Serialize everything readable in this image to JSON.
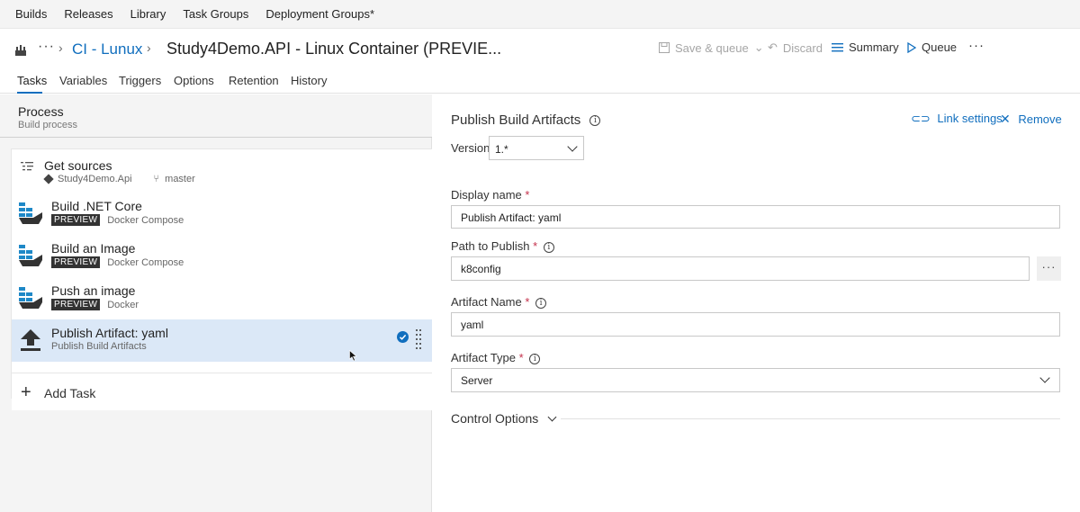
{
  "topnav": {
    "items": [
      "Builds",
      "Releases",
      "Library",
      "Task Groups",
      "Deployment Groups*"
    ]
  },
  "breadcrumb": {
    "more": "···",
    "link": "CI - Lunux",
    "title": "Study4Demo.API - Linux Container (PREVIE..."
  },
  "toolbar": {
    "save_queue": "Save & queue",
    "discard": "Discard",
    "summary": "Summary",
    "queue": "Queue",
    "more": "···"
  },
  "tabs": [
    "Tasks",
    "Variables",
    "Triggers",
    "Options",
    "Retention",
    "History"
  ],
  "process": {
    "title": "Process",
    "subtitle": "Build process"
  },
  "get_sources": {
    "name": "Get sources",
    "repo": "Study4Demo.Api",
    "branch": "master"
  },
  "tasks": [
    {
      "name": "Build .NET Core",
      "badge": "PREVIEW",
      "sub": "Docker Compose"
    },
    {
      "name": "Build an Image",
      "badge": "PREVIEW",
      "sub": "Docker Compose"
    },
    {
      "name": "Push an image",
      "badge": "PREVIEW",
      "sub": "Docker"
    },
    {
      "name": "Publish Artifact: yaml",
      "badge": "",
      "sub": "Publish Build Artifacts"
    }
  ],
  "add_task": "Add Task",
  "detail": {
    "title": "Publish Build Artifacts",
    "link_settings": "Link settings",
    "remove": "Remove",
    "version_label": "Version",
    "version_value": "1.*",
    "display_name_label": "Display name",
    "display_name_value": "Publish Artifact: yaml",
    "path_label": "Path to Publish",
    "path_value": "k8config",
    "path_browse": "···",
    "artifact_name_label": "Artifact Name",
    "artifact_name_value": "yaml",
    "artifact_type_label": "Artifact Type",
    "artifact_type_value": "Server",
    "control_options": "Control Options",
    "required_mark": "*"
  }
}
